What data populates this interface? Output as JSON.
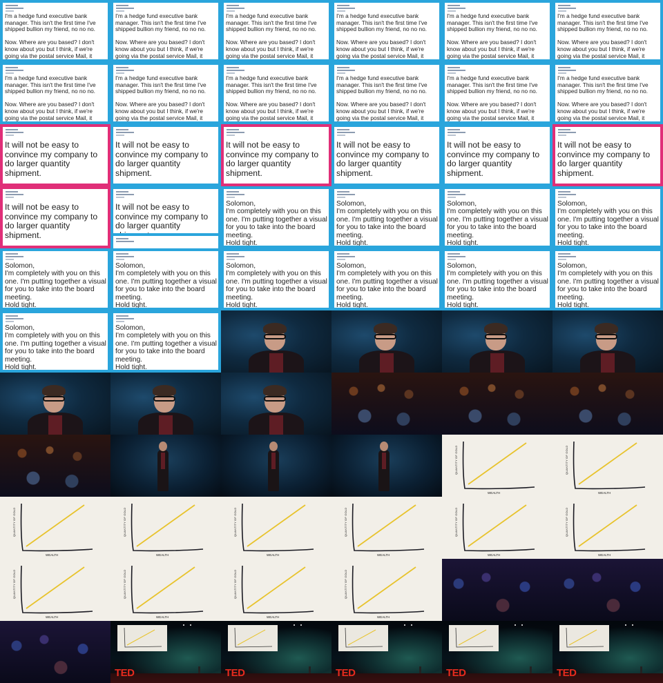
{
  "texts": {
    "bullion": "I'm a hedge fund executive bank manager. This isn't the first time I've shipped bullion my friend, no no no.\n\nNow. Where are you based? I don't know about you but I think, if we're going via the postal service Mail, it ought to be signed for.",
    "convince": "It will not be easy to convince my company to do larger quantity shipment.",
    "solomon": "Solomon,\nI'm completely with you on this one. I'm putting together a visual for you to take into the board meeting.\nHold tight."
  },
  "chart": {
    "ylabel": "QUANTITY OF GOLD",
    "xlabel": "WEALTH",
    "line_color": "#e8c32c"
  },
  "brand": {
    "logo": "TED",
    "color": "#e62b1e"
  },
  "colors": {
    "email_border": "#2aa5dc",
    "pink_border": "#e02f78"
  },
  "cells": [
    {
      "kind": "email",
      "text": "bullion"
    },
    {
      "kind": "email",
      "text": "bullion"
    },
    {
      "kind": "email",
      "text": "bullion"
    },
    {
      "kind": "email",
      "text": "bullion"
    },
    {
      "kind": "email",
      "text": "bullion"
    },
    {
      "kind": "email",
      "text": "bullion"
    },
    {
      "kind": "email",
      "text": "bullion"
    },
    {
      "kind": "email",
      "text": "bullion"
    },
    {
      "kind": "email",
      "text": "bullion"
    },
    {
      "kind": "email",
      "text": "bullion"
    },
    {
      "kind": "email",
      "text": "bullion"
    },
    {
      "kind": "email",
      "text": "bullion"
    },
    {
      "kind": "pink",
      "text": "convince"
    },
    {
      "kind": "email",
      "text": "convince"
    },
    {
      "kind": "pink",
      "text": "convince"
    },
    {
      "kind": "email",
      "text": "convince"
    },
    {
      "kind": "email",
      "text": "convince"
    },
    {
      "kind": "pink",
      "text": "convince"
    },
    {
      "kind": "pink",
      "text": "convince"
    },
    {
      "kind": "transition",
      "text": "convince"
    },
    {
      "kind": "email",
      "text": "solomon"
    },
    {
      "kind": "email",
      "text": "solomon"
    },
    {
      "kind": "email",
      "text": "solomon"
    },
    {
      "kind": "email",
      "text": "solomon"
    },
    {
      "kind": "email",
      "text": "solomon"
    },
    {
      "kind": "email",
      "text": "solomon"
    },
    {
      "kind": "email",
      "text": "solomon"
    },
    {
      "kind": "email",
      "text": "solomon"
    },
    {
      "kind": "email",
      "text": "solomon"
    },
    {
      "kind": "email",
      "text": "solomon"
    },
    {
      "kind": "email",
      "text": "solomon"
    },
    {
      "kind": "email",
      "text": "solomon"
    },
    {
      "kind": "speaker"
    },
    {
      "kind": "speaker"
    },
    {
      "kind": "speaker"
    },
    {
      "kind": "speaker"
    },
    {
      "kind": "speaker"
    },
    {
      "kind": "speaker"
    },
    {
      "kind": "speaker"
    },
    {
      "kind": "audience"
    },
    {
      "kind": "audience"
    },
    {
      "kind": "audience"
    },
    {
      "kind": "audience"
    },
    {
      "kind": "speaker-wide"
    },
    {
      "kind": "speaker-wide"
    },
    {
      "kind": "speaker-wide"
    },
    {
      "kind": "chart"
    },
    {
      "kind": "chart"
    },
    {
      "kind": "chart"
    },
    {
      "kind": "chart"
    },
    {
      "kind": "chart"
    },
    {
      "kind": "chart"
    },
    {
      "kind": "chart"
    },
    {
      "kind": "chart"
    },
    {
      "kind": "chart"
    },
    {
      "kind": "chart"
    },
    {
      "kind": "chart"
    },
    {
      "kind": "chart"
    },
    {
      "kind": "audience-blue"
    },
    {
      "kind": "audience-blue"
    },
    {
      "kind": "audience-blue"
    },
    {
      "kind": "stage"
    },
    {
      "kind": "stage"
    },
    {
      "kind": "stage"
    },
    {
      "kind": "stage"
    },
    {
      "kind": "stage"
    }
  ]
}
